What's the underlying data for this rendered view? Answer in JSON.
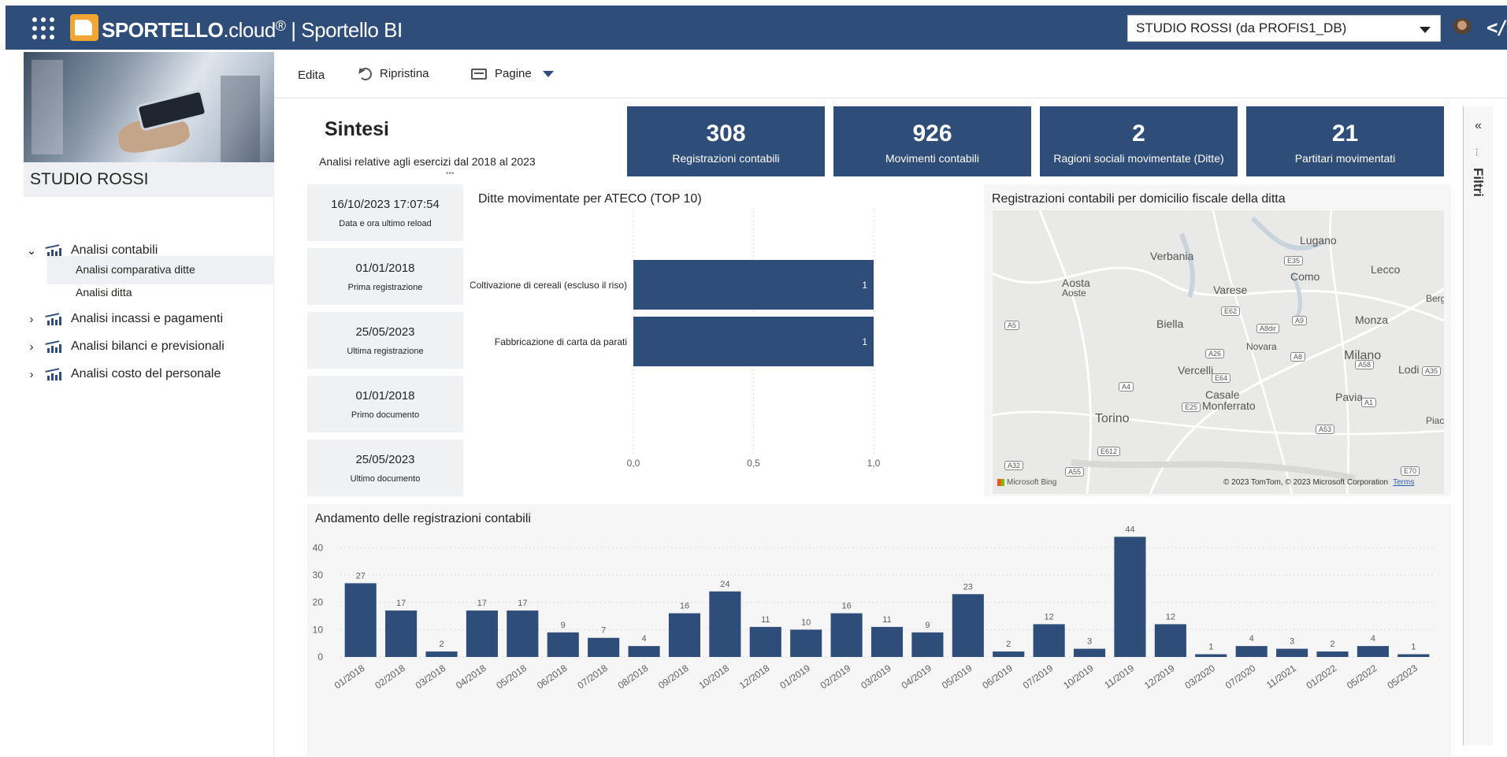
{
  "topbar": {
    "brand_bold": "SPORTELLO",
    "brand_light": ".cloud",
    "brand_reg": "®",
    "separator": " | ",
    "app_name": "Sportello BI",
    "tenant": "STUDIO ROSSI (da PROFIS1_DB)"
  },
  "sidebar": {
    "studio": "STUDIO ROSSI",
    "groups": [
      {
        "label": "Analisi contabili",
        "expanded": true,
        "items": [
          "Analisi comparativa ditte",
          "Analisi ditta"
        ]
      },
      {
        "label": "Analisi incassi e pagamenti",
        "expanded": false
      },
      {
        "label": "Analisi bilanci e previsionali",
        "expanded": false
      },
      {
        "label": "Analisi costo del personale",
        "expanded": false
      }
    ]
  },
  "toolbar": {
    "edit": "Edita",
    "reset": "Ripristina",
    "pages": "Pagine"
  },
  "header": {
    "title": "Sintesi",
    "subtitle": "Analisi relative agli esercizi dal 2018 al 2023"
  },
  "kpis": [
    {
      "value": "308",
      "label": "Registrazioni contabili"
    },
    {
      "value": "926",
      "label": "Movimenti contabili"
    },
    {
      "value": "2",
      "label": "Ragioni sociali movimentate (Ditte)"
    },
    {
      "value": "21",
      "label": "Partitari movimentati"
    }
  ],
  "date_cards": [
    {
      "value": "16/10/2023 17:07:54",
      "label": "Data e ora ultimo reload"
    },
    {
      "value": "01/01/2018",
      "label": "Prima registrazione"
    },
    {
      "value": "25/05/2023",
      "label": "Ultima registrazione"
    },
    {
      "value": "01/01/2018",
      "label": "Primo documento"
    },
    {
      "value": "25/05/2023",
      "label": "Ultimo documento"
    }
  ],
  "map": {
    "title": "Registrazioni contabili per domicilio fiscale della ditta",
    "places": [
      "Lugano",
      "Verbania",
      "Lecco",
      "Aosta",
      "Aoste",
      "Como",
      "Varese",
      "Berga",
      "Biella",
      "Monza",
      "Novara",
      "Milano",
      "Vercelli",
      "Lodi",
      "Casale",
      "Monferrato",
      "Pavia",
      "Torino",
      "Piac"
    ],
    "roads": [
      "E35",
      "E62",
      "A9",
      "A5",
      "A8dir",
      "A26",
      "A8",
      "A58",
      "A35",
      "E64",
      "A4",
      "A1",
      "E25",
      "A53",
      "E612",
      "A32",
      "A55",
      "E70"
    ],
    "bing": "Microsoft Bing",
    "credit": "© 2023 TomTom, © 2023 Microsoft Corporation",
    "terms": "Terms"
  },
  "filters": {
    "collapse": "«",
    "label": "Filtri"
  },
  "chart_data": [
    {
      "type": "bar",
      "orientation": "horizontal",
      "title": "Ditte movimentate per ATECO (TOP 10)",
      "categories": [
        "Coltivazione di cereali (escluso il riso)",
        "Fabbricazione di carta da parati"
      ],
      "values": [
        1,
        1
      ],
      "data_labels": [
        "1",
        "1"
      ],
      "xlim": [
        0,
        1
      ],
      "xticks": [
        "0,0",
        "0,5",
        "1,0"
      ],
      "color": "#2f4d79",
      "grid": true
    },
    {
      "type": "bar",
      "title": "Andamento delle registrazioni contabili",
      "categories": [
        "01/2018",
        "02/2018",
        "03/2018",
        "04/2018",
        "05/2018",
        "06/2018",
        "07/2018",
        "08/2018",
        "09/2018",
        "10/2018",
        "12/2018",
        "01/2019",
        "02/2019",
        "03/2019",
        "04/2019",
        "05/2019",
        "06/2019",
        "07/2019",
        "10/2019",
        "11/2019",
        "12/2019",
        "03/2020",
        "07/2020",
        "11/2021",
        "01/2022",
        "05/2022",
        "05/2023"
      ],
      "values": [
        27,
        17,
        2,
        17,
        17,
        9,
        7,
        4,
        16,
        24,
        11,
        10,
        16,
        11,
        9,
        23,
        2,
        12,
        3,
        44,
        12,
        1,
        4,
        3,
        2,
        4,
        1
      ],
      "ylim": [
        0,
        45
      ],
      "yticks": [
        0,
        10,
        20,
        30,
        40
      ],
      "color": "#2f4d79",
      "grid": true
    }
  ]
}
